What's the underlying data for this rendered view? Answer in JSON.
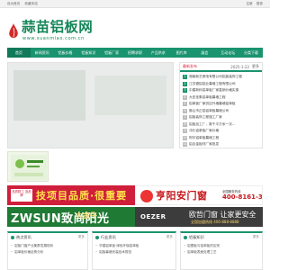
{
  "topbar": {
    "left": [
      "设为首页",
      "收藏本站"
    ],
    "right": [
      "注册",
      "登录"
    ]
  },
  "logo": {
    "title": "蒜苗铝板网",
    "url": "www.suanmiao.com.cn"
  },
  "nav": {
    "items": [
      "首页",
      "新闻资讯",
      "铝板价格",
      "铝板知识",
      "铝板厂家",
      "招聘求职",
      "产品供求",
      "图片库",
      "展会",
      "互动论坛",
      "分类下载"
    ]
  },
  "news_panel": {
    "title": "最新发布",
    "date": "2025-1-22",
    "more": "更多",
    "items": [
      {
        "num": "1",
        "text": "湖南新艺瓷电有限公司铝板装饰工程"
      },
      {
        "num": "2",
        "text": "江苏德铝铝业幕墙工程有限公司"
      },
      {
        "num": "3",
        "text": "中建新科铝单板厂家直销价格实惠"
      },
      {
        "num": "4",
        "text": "大亚圣象铝单板幕墙工程"
      },
      {
        "num": "5",
        "text": "铝单板厂家供应外墙幕墙铝单板"
      },
      {
        "num": "6",
        "text": "佛山市正铝铝单板幕墙公司"
      },
      {
        "num": "7",
        "text": "铝板装饰工程施工厂家"
      },
      {
        "num": "8",
        "text": "铝板加工厂，数千平方米一次..."
      },
      {
        "num": "9",
        "text": "冲孔铝单板厂家价格"
      },
      {
        "num": "10",
        "text": "阿尔铝单板幕墙工程"
      },
      {
        "num": "11",
        "text": "铝合金板材厂家批发"
      },
      {
        "num": "12",
        "text": "双曲铝单板加工定制"
      }
    ]
  },
  "ads": {
    "ad1_text": "技项目品质·很重要",
    "ad1_badge": "品质精工 选品牌",
    "ad2_text": "亨阳安门窗",
    "ad2_tel_label": "全国服务热线",
    "ad2_tel": "400-8161-322",
    "ad3_text": "ZWSUN致尚阳光",
    "ad3_text2": "大金牛",
    "ad4_brand": "OEZER",
    "ad4_slogan": "欧哲门窗 让家更安全",
    "ad4_tel": "全国加盟热线 400-888-8888"
  },
  "boxes": [
    {
      "title": "热点资讯",
      "more": "更多",
      "items": [
        "铝板门窗产业集群发展现状",
        "铝单板价格走势分析"
      ]
    },
    {
      "title": "行业资讯",
      "more": "更多",
      "items": [
        "华建铝单板·绿色环保铝单板",
        "铝板幕墙安装技术规范"
      ]
    },
    {
      "title": "铝板知识",
      "more": "更多",
      "items": [
        "铝塑板与铝单板的区别",
        "铝单板表面处理工艺"
      ]
    }
  ]
}
